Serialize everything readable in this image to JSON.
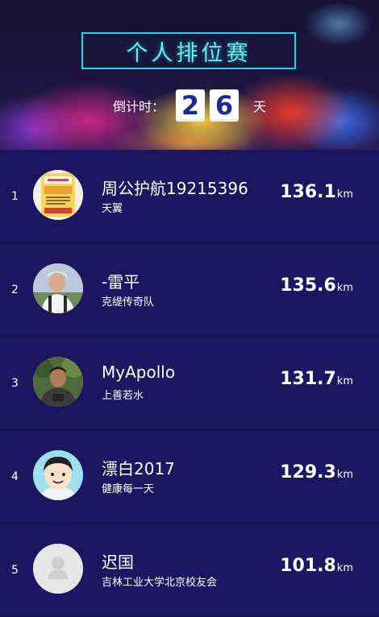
{
  "header": {
    "title": "个人排位赛",
    "countdown_label": "倒计时：",
    "countdown_digits": [
      "2",
      "6"
    ],
    "countdown_unit": "天"
  },
  "leaderboard": [
    {
      "rank": "1",
      "name": "周公护航19215396",
      "team": "天翼",
      "distance": "136.1",
      "unit": "km",
      "avatar": "poster-image"
    },
    {
      "rank": "2",
      "name": "-雷平",
      "team": "克缇传奇队",
      "distance": "135.6",
      "unit": "km",
      "avatar": "person-photo"
    },
    {
      "rank": "3",
      "name": "MyApollo",
      "team": "上善若水",
      "distance": "131.7",
      "unit": "km",
      "avatar": "person-photo"
    },
    {
      "rank": "4",
      "name": "漂白2017",
      "team": "健康每一天",
      "distance": "129.3",
      "unit": "km",
      "avatar": "cartoon-face"
    },
    {
      "rank": "5",
      "name": "迟国",
      "team": "吉林工业大学北京校友会",
      "distance": "101.8",
      "unit": "km",
      "avatar": "default-avatar"
    }
  ]
}
